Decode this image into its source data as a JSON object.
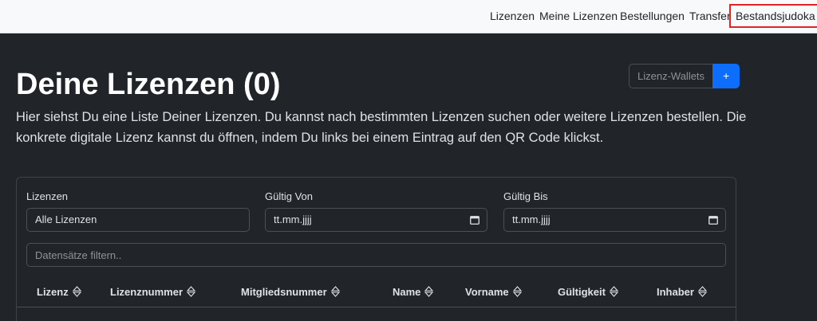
{
  "nav": {
    "items": [
      {
        "label": "Lizenzen"
      },
      {
        "label": "Meine Lizenzen"
      },
      {
        "label": "Bestellungen"
      },
      {
        "label": "Transfer"
      },
      {
        "label": "Bestandsjudoka"
      }
    ]
  },
  "header": {
    "title": "Deine Lizenzen (0)",
    "intro": "Hier siehst Du eine Liste Deiner Lizenzen. Du kannst nach bestimmten Lizenzen suchen oder weitere Lizenzen bestellen. Die konkrete digitale Lizenz kannst du öffnen, indem Du links bei einem Eintrag auf den QR Code klickst.",
    "wallets_label": "Lizenz-Wallets",
    "add_label": "+"
  },
  "filters": {
    "license": {
      "label": "Lizenzen",
      "value": "Alle Lizenzen"
    },
    "valid_from": {
      "label": "Gültig Von",
      "value": "tt.mm.jjjj"
    },
    "valid_to": {
      "label": "Gültig Bis",
      "value": "tt.mm.jjjj"
    },
    "search_placeholder": "Datensätze filtern.."
  },
  "table": {
    "columns": [
      "Lizenz",
      "Lizenznummer",
      "Mitgliedsnummer",
      "Name",
      "Vorname",
      "Gültigkeit",
      "Inhaber"
    ]
  },
  "colors": {
    "background": "#212529",
    "navbar": "#f8f9fa",
    "primary": "#0d6efd",
    "highlight": "#e02424"
  }
}
